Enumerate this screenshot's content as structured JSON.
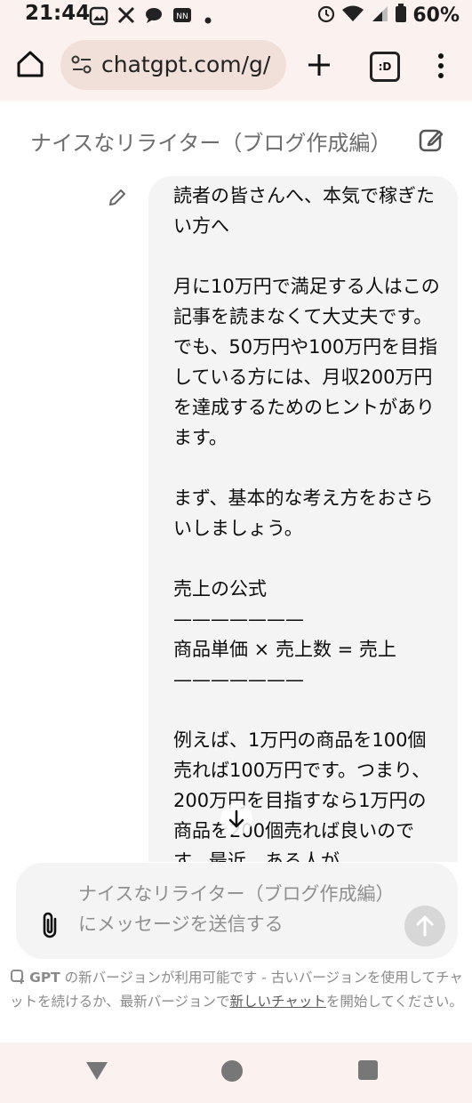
{
  "status_bar": {
    "time": "21:44",
    "battery": "60%",
    "icons": [
      "gallery-icon",
      "x-icon",
      "chat-bubble-icon",
      "app-badge-icon",
      "dot-icon",
      "alarm-icon",
      "wifi-icon",
      "signal-icon",
      "battery-icon"
    ]
  },
  "browser": {
    "url": "chatgpt.com/g/",
    "tabs_label": ":D"
  },
  "chat": {
    "title": "ナイスなリライター（ブログ作成編）",
    "message_text": "読者の皆さんへ、本気で稼ぎたい方へ\n\n月に10万円で満足する人はこの記事を読まなくて大丈夫です。でも、50万円や100万円を目指している方には、月収200万円を達成するためのヒントがあります。\n\nまず、基本的な考え方をおさらいしましょう。\n\n売上の公式\n———————\n商品単価 × 売上数 = 売上\n———————\n\n例えば、1万円の商品を100個売れば100万円です。つまり、200万円を目指すなら1万円の商品を200個売れば良いのです。最近、ある人が"
  },
  "composer": {
    "placeholder": "ナイスなリライター（ブログ作成編）にメッセージを送信する"
  },
  "notice": {
    "part1": "GPT",
    "part2": " の新バージョンが利用可能です - 古いバージョンを使用してチャットを続けるか、最新バージョンで",
    "link": "新しいチャット",
    "part3": "を開始してください。"
  },
  "colors": {
    "browser_chrome": "#fbf1ee",
    "urlbar": "#f1e0d9",
    "bubble": "#f4f4f4",
    "muted_text": "#8a8a8a"
  }
}
